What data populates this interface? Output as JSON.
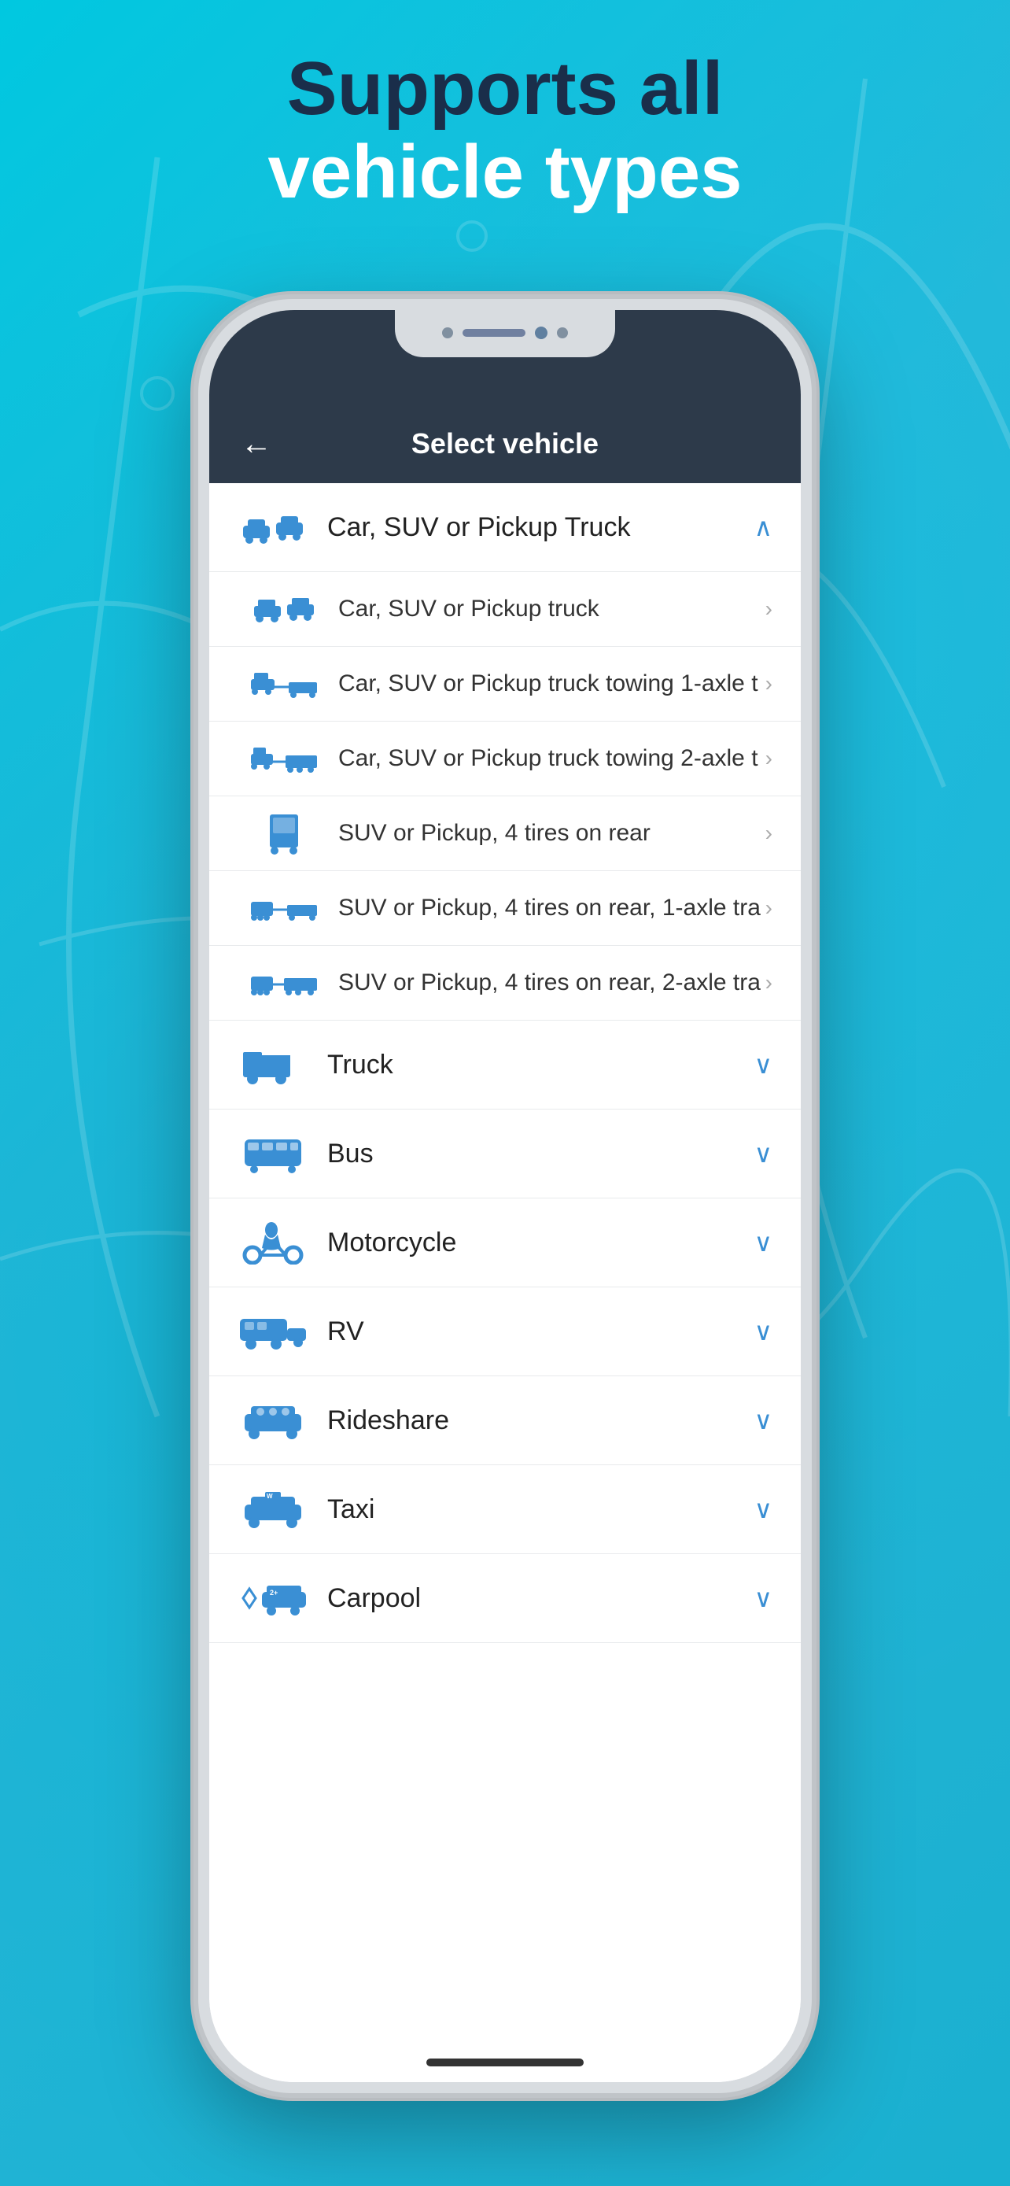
{
  "hero": {
    "line1": "Supports all",
    "line2": "vehicle types"
  },
  "header": {
    "title": "Select vehicle",
    "back_label": "←"
  },
  "categories": [
    {
      "id": "car-suv",
      "label": "Car, SUV or Pickup Truck",
      "expanded": true,
      "chevron": "∧",
      "sub_items": [
        {
          "label": "Car, SUV or Pickup truck",
          "truncated": false
        },
        {
          "label": "Car, SUV or Pickup truck towing 1-axle t",
          "truncated": true
        },
        {
          "label": "Car, SUV or Pickup truck towing 2-axle t",
          "truncated": true
        },
        {
          "label": "SUV or Pickup, 4 tires on rear",
          "truncated": false
        },
        {
          "label": "SUV or Pickup, 4 tires on rear, 1-axle tra",
          "truncated": true
        },
        {
          "label": "SUV or Pickup, 4 tires on rear, 2-axle tra",
          "truncated": true
        }
      ]
    },
    {
      "id": "truck",
      "label": "Truck",
      "expanded": false,
      "chevron": "∨",
      "sub_items": []
    },
    {
      "id": "bus",
      "label": "Bus",
      "expanded": false,
      "chevron": "∨",
      "sub_items": []
    },
    {
      "id": "motorcycle",
      "label": "Motorcycle",
      "expanded": false,
      "chevron": "∨",
      "sub_items": []
    },
    {
      "id": "rv",
      "label": "RV",
      "expanded": false,
      "chevron": "∨",
      "sub_items": []
    },
    {
      "id": "rideshare",
      "label": "Rideshare",
      "expanded": false,
      "chevron": "∨",
      "sub_items": []
    },
    {
      "id": "taxi",
      "label": "Taxi",
      "expanded": false,
      "chevron": "∨",
      "sub_items": []
    },
    {
      "id": "carpool",
      "label": "Carpool",
      "expanded": false,
      "chevron": "∨",
      "sub_items": []
    }
  ],
  "colors": {
    "accent": "#3a8fd4",
    "header_bg": "#2d3a4a",
    "text_dark": "#1a2e4a",
    "text_white": "#ffffff"
  }
}
